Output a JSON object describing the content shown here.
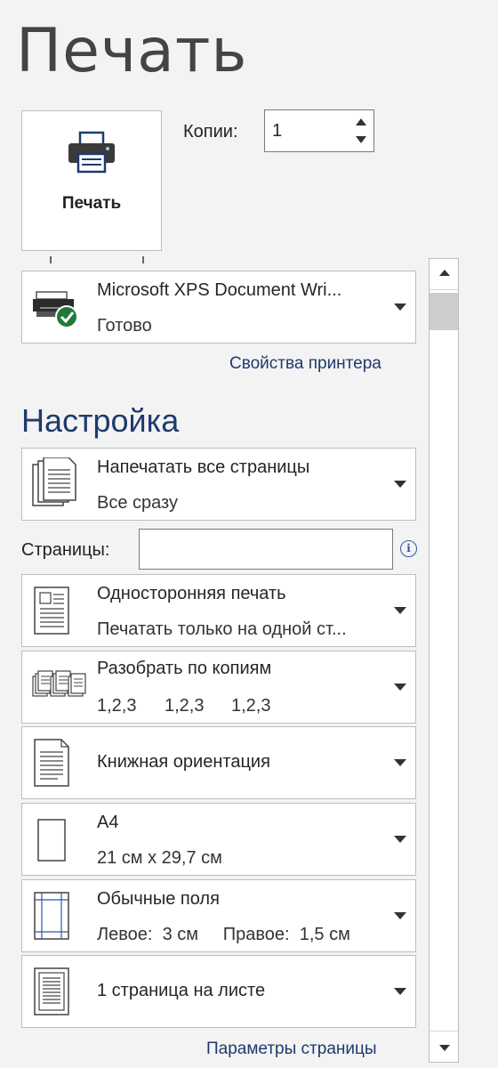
{
  "page_title": "Печать",
  "print_button_label": "Печать",
  "copies": {
    "label": "Копии:",
    "value": "1"
  },
  "printer": {
    "name": "Microsoft XPS Document Wri...",
    "status": "Готово",
    "properties_link": "Свойства принтера"
  },
  "settings": {
    "title": "Настройка",
    "print_range": {
      "main": "Напечатать все страницы",
      "sub": "Все сразу"
    },
    "pages_label": "Страницы:",
    "pages_value": "",
    "sides": {
      "main": "Односторонняя печать",
      "sub": "Печатать только на одной ст..."
    },
    "collate": {
      "main": "Разобрать по копиям",
      "sub": [
        "1,2,3",
        "1,2,3",
        "1,2,3"
      ]
    },
    "orientation": {
      "main": "Книжная ориентация"
    },
    "paper": {
      "main": "A4",
      "sub": "21 см x 29,7 см"
    },
    "margins": {
      "main": "Обычные поля",
      "sub": "Левое:  3 см     Правое:  1,5 см"
    },
    "pages_per_sheet": {
      "main": "1 страница на листе"
    },
    "page_setup_link": "Параметры страницы"
  }
}
